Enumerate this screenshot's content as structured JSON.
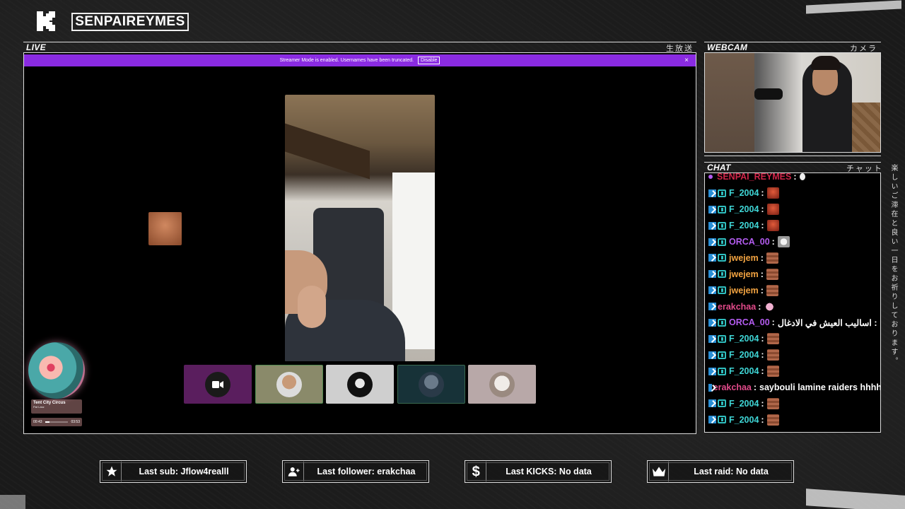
{
  "header": {
    "logo_icon": "kick-logo-icon",
    "channel_name": "SENPAIREYMES"
  },
  "live": {
    "label": "LIVE",
    "jp_label": "生放送",
    "banner": {
      "message": "Streamer Mode is enabled. Usernames have been truncated.",
      "disable_label": "Disable",
      "close_label": "×",
      "color": "#8a2be2"
    },
    "participants": [
      {
        "name": "camera-off-participant",
        "bg": "#5a1e5e"
      },
      {
        "name": "participant-2",
        "bg": "#8a8a6a"
      },
      {
        "name": "participant-3",
        "bg": "#cfcfcf"
      },
      {
        "name": "participant-4",
        "bg": "#173238"
      },
      {
        "name": "participant-5",
        "bg": "#b8a8a8"
      }
    ]
  },
  "music": {
    "title": "Tent City Circus",
    "artist": "Pat Lasz",
    "elapsed": "00:43",
    "duration": "03:53",
    "progress": 0.18
  },
  "webcam": {
    "label": "WEBCAM",
    "jp_label": "カメラ"
  },
  "chat": {
    "label": "CHAT",
    "jp_label": "チャット",
    "messages": [
      {
        "user": "SENPAI_REYMES",
        "color": "#d0264a",
        "badges": [],
        "message": "",
        "emote": "drop",
        "partial": true
      },
      {
        "user": "F_2004",
        "color": "#3fd6d6",
        "badges": [
          "kick",
          "sub"
        ],
        "message": "",
        "emote": "red"
      },
      {
        "user": "F_2004",
        "color": "#3fd6d6",
        "badges": [
          "kick",
          "sub"
        ],
        "message": "",
        "emote": "red"
      },
      {
        "user": "F_2004",
        "color": "#3fd6d6",
        "badges": [
          "kick",
          "sub"
        ],
        "message": "",
        "emote": "red"
      },
      {
        "user": "ORCA_00",
        "color": "#b45cf0",
        "badges": [
          "kick",
          "sub"
        ],
        "message": "",
        "emote": "cat"
      },
      {
        "user": "jwejem",
        "color": "#f2a341",
        "badges": [
          "kick",
          "sub"
        ],
        "message": "",
        "emote": "brown"
      },
      {
        "user": "jwejem",
        "color": "#f2a341",
        "badges": [
          "kick",
          "sub"
        ],
        "message": "",
        "emote": "brown"
      },
      {
        "user": "jwejem",
        "color": "#f2a341",
        "badges": [
          "kick",
          "sub"
        ],
        "message": "",
        "emote": "brown"
      },
      {
        "user": "erakchaa",
        "color": "#e24a8a",
        "badges": [
          "kick"
        ],
        "message": "",
        "emote": "pink"
      },
      {
        "user": "ORCA_00",
        "color": "#b45cf0",
        "badges": [
          "kick",
          "sub"
        ],
        "message": "اساليب العيش في الادغال :",
        "emote": ""
      },
      {
        "user": "F_2004",
        "color": "#3fd6d6",
        "badges": [
          "kick",
          "sub"
        ],
        "message": "",
        "emote": "brown"
      },
      {
        "user": "F_2004",
        "color": "#3fd6d6",
        "badges": [
          "kick",
          "sub"
        ],
        "message": "",
        "emote": "brown"
      },
      {
        "user": "F_2004",
        "color": "#3fd6d6",
        "badges": [
          "kick",
          "sub"
        ],
        "message": "",
        "emote": "brown"
      },
      {
        "user": "erakchaa",
        "color": "#e24a8a",
        "badges": [
          "kick"
        ],
        "message": "saybouli lamine raiders hhhh",
        "emote": ""
      },
      {
        "user": "F_2004",
        "color": "#3fd6d6",
        "badges": [
          "kick",
          "sub"
        ],
        "message": "",
        "emote": "brown"
      },
      {
        "user": "F_2004",
        "color": "#3fd6d6",
        "badges": [
          "kick",
          "sub"
        ],
        "message": "",
        "emote": "brown"
      }
    ]
  },
  "side_text": "楽しいご滞在と良い一日をお祈りしております。",
  "stats": [
    {
      "icon": "star-icon",
      "text": "Last sub: Jflow4realll"
    },
    {
      "icon": "add-user-icon",
      "text": "Last follower: erakchaa"
    },
    {
      "icon": "dollar-icon",
      "text": "Last KICKS: No data"
    },
    {
      "icon": "crown-icon",
      "text": "Last raid: No data"
    }
  ]
}
